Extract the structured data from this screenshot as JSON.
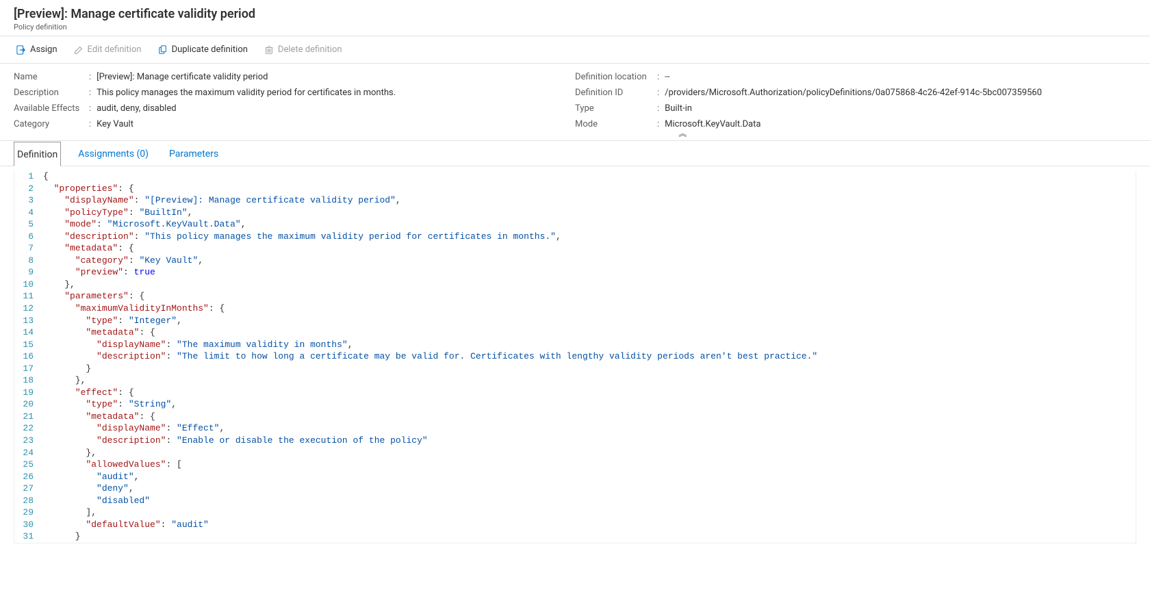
{
  "header": {
    "title": "[Preview]: Manage certificate validity period",
    "subtitle": "Policy definition"
  },
  "toolbar": {
    "assign": "Assign",
    "edit": "Edit definition",
    "duplicate": "Duplicate definition",
    "delete": "Delete definition"
  },
  "props": {
    "left": {
      "name_label": "Name",
      "name_value": "[Preview]: Manage certificate validity period",
      "description_label": "Description",
      "description_value": "This policy manages the maximum validity period for certificates in months.",
      "effects_label": "Available Effects",
      "effects_value": "audit, deny, disabled",
      "category_label": "Category",
      "category_value": "Key Vault"
    },
    "right": {
      "location_label": "Definition location",
      "location_value": "--",
      "id_label": "Definition ID",
      "id_value": "/providers/Microsoft.Authorization/policyDefinitions/0a075868-4c26-42ef-914c-5bc007359560",
      "type_label": "Type",
      "type_value": "Built-in",
      "mode_label": "Mode",
      "mode_value": "Microsoft.KeyVault.Data"
    }
  },
  "tabs": {
    "definition": "Definition",
    "assignments": "Assignments (0)",
    "parameters": "Parameters"
  },
  "code": {
    "lines": [
      [
        [
          "brace",
          "{"
        ]
      ],
      [
        [
          "punc",
          "  "
        ],
        [
          "key",
          "\"properties\""
        ],
        [
          "punc",
          ": {"
        ]
      ],
      [
        [
          "punc",
          "    "
        ],
        [
          "key",
          "\"displayName\""
        ],
        [
          "punc",
          ": "
        ],
        [
          "str",
          "\"[Preview]: Manage certificate validity period\""
        ],
        [
          "punc",
          ","
        ]
      ],
      [
        [
          "punc",
          "    "
        ],
        [
          "key",
          "\"policyType\""
        ],
        [
          "punc",
          ": "
        ],
        [
          "str",
          "\"BuiltIn\""
        ],
        [
          "punc",
          ","
        ]
      ],
      [
        [
          "punc",
          "    "
        ],
        [
          "key",
          "\"mode\""
        ],
        [
          "punc",
          ": "
        ],
        [
          "str",
          "\"Microsoft.KeyVault.Data\""
        ],
        [
          "punc",
          ","
        ]
      ],
      [
        [
          "punc",
          "    "
        ],
        [
          "key",
          "\"description\""
        ],
        [
          "punc",
          ": "
        ],
        [
          "str",
          "\"This policy manages the maximum validity period for certificates in months.\""
        ],
        [
          "punc",
          ","
        ]
      ],
      [
        [
          "punc",
          "    "
        ],
        [
          "key",
          "\"metadata\""
        ],
        [
          "punc",
          ": {"
        ]
      ],
      [
        [
          "punc",
          "      "
        ],
        [
          "key",
          "\"category\""
        ],
        [
          "punc",
          ": "
        ],
        [
          "str",
          "\"Key Vault\""
        ],
        [
          "punc",
          ","
        ]
      ],
      [
        [
          "punc",
          "      "
        ],
        [
          "key",
          "\"preview\""
        ],
        [
          "punc",
          ": "
        ],
        [
          "bool",
          "true"
        ]
      ],
      [
        [
          "punc",
          "    },"
        ]
      ],
      [
        [
          "punc",
          "    "
        ],
        [
          "key",
          "\"parameters\""
        ],
        [
          "punc",
          ": {"
        ]
      ],
      [
        [
          "punc",
          "      "
        ],
        [
          "key",
          "\"maximumValidityInMonths\""
        ],
        [
          "punc",
          ": {"
        ]
      ],
      [
        [
          "punc",
          "        "
        ],
        [
          "key",
          "\"type\""
        ],
        [
          "punc",
          ": "
        ],
        [
          "str",
          "\"Integer\""
        ],
        [
          "punc",
          ","
        ]
      ],
      [
        [
          "punc",
          "        "
        ],
        [
          "key",
          "\"metadata\""
        ],
        [
          "punc",
          ": {"
        ]
      ],
      [
        [
          "punc",
          "          "
        ],
        [
          "key",
          "\"displayName\""
        ],
        [
          "punc",
          ": "
        ],
        [
          "str",
          "\"The maximum validity in months\""
        ],
        [
          "punc",
          ","
        ]
      ],
      [
        [
          "punc",
          "          "
        ],
        [
          "key",
          "\"description\""
        ],
        [
          "punc",
          ": "
        ],
        [
          "str",
          "\"The limit to how long a certificate may be valid for. Certificates with lengthy validity periods aren't best practice.\""
        ]
      ],
      [
        [
          "punc",
          "        }"
        ]
      ],
      [
        [
          "punc",
          "      },"
        ]
      ],
      [
        [
          "punc",
          "      "
        ],
        [
          "key",
          "\"effect\""
        ],
        [
          "punc",
          ": {"
        ]
      ],
      [
        [
          "punc",
          "        "
        ],
        [
          "key",
          "\"type\""
        ],
        [
          "punc",
          ": "
        ],
        [
          "str",
          "\"String\""
        ],
        [
          "punc",
          ","
        ]
      ],
      [
        [
          "punc",
          "        "
        ],
        [
          "key",
          "\"metadata\""
        ],
        [
          "punc",
          ": {"
        ]
      ],
      [
        [
          "punc",
          "          "
        ],
        [
          "key",
          "\"displayName\""
        ],
        [
          "punc",
          ": "
        ],
        [
          "str",
          "\"Effect\""
        ],
        [
          "punc",
          ","
        ]
      ],
      [
        [
          "punc",
          "          "
        ],
        [
          "key",
          "\"description\""
        ],
        [
          "punc",
          ": "
        ],
        [
          "str",
          "\"Enable or disable the execution of the policy\""
        ]
      ],
      [
        [
          "punc",
          "        },"
        ]
      ],
      [
        [
          "punc",
          "        "
        ],
        [
          "key",
          "\"allowedValues\""
        ],
        [
          "punc",
          ": ["
        ]
      ],
      [
        [
          "punc",
          "          "
        ],
        [
          "str",
          "\"audit\""
        ],
        [
          "punc",
          ","
        ]
      ],
      [
        [
          "punc",
          "          "
        ],
        [
          "str",
          "\"deny\""
        ],
        [
          "punc",
          ","
        ]
      ],
      [
        [
          "punc",
          "          "
        ],
        [
          "str",
          "\"disabled\""
        ]
      ],
      [
        [
          "punc",
          "        ],"
        ]
      ],
      [
        [
          "punc",
          "        "
        ],
        [
          "key",
          "\"defaultValue\""
        ],
        [
          "punc",
          ": "
        ],
        [
          "str",
          "\"audit\""
        ]
      ],
      [
        [
          "punc",
          "      }"
        ]
      ]
    ]
  }
}
